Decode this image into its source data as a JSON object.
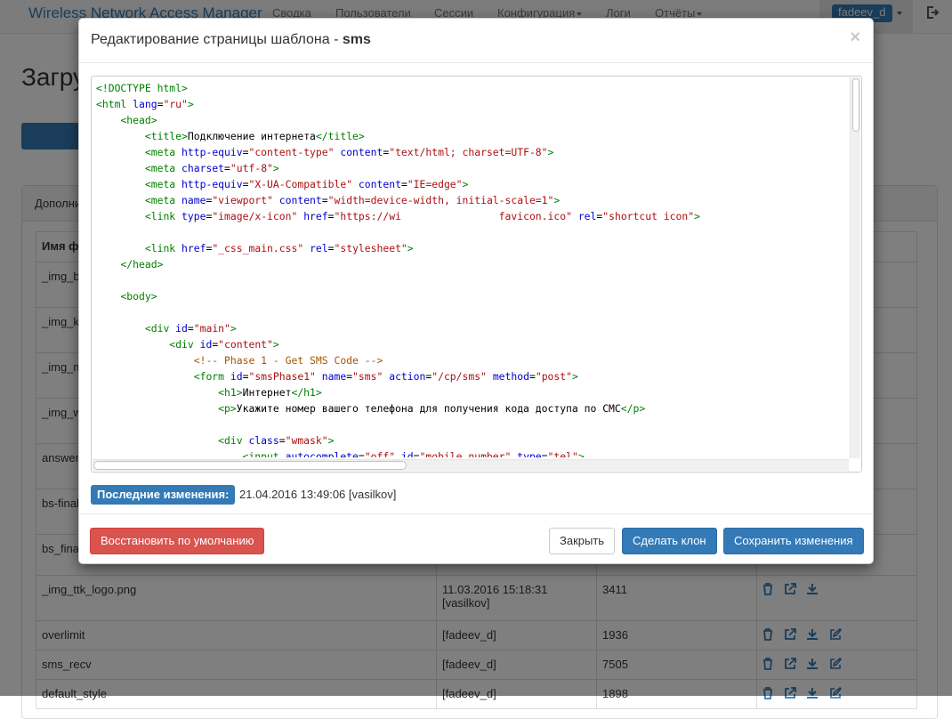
{
  "navbar": {
    "brand": "Wireless Network Access Manager",
    "items": [
      {
        "label": "Сводка",
        "dropdown": false
      },
      {
        "label": "Пользователи",
        "dropdown": false
      },
      {
        "label": "Сессии",
        "dropdown": false
      },
      {
        "label": "Конфигурация",
        "dropdown": true
      },
      {
        "label": "Логи",
        "dropdown": false
      },
      {
        "label": "Отчёты",
        "dropdown": true
      }
    ],
    "user": "fadeev_d"
  },
  "page": {
    "title_partial": "Загру",
    "panel_heading_partial": "Дополни"
  },
  "table": {
    "header_col1_partial": "Имя ф",
    "partial_rows": [
      "_img_b",
      "_img_k",
      "_img_m",
      "_img_w",
      "answer",
      "bs-final",
      "bs_fina"
    ],
    "rows": [
      {
        "name": "_img_ttk_logo.png",
        "changed": "11.03.2016 15:18:31\n[vasilkov]",
        "size": "3411",
        "edit_icon": false
      },
      {
        "name": "overlimit",
        "changed": "[fadeev_d]",
        "size": "1936",
        "edit_icon": true
      },
      {
        "name": "sms_recv",
        "changed": "[fadeev_d]",
        "size": "7505",
        "edit_icon": true
      },
      {
        "name": "default_style",
        "changed": "[fadeev_d]",
        "size": "1898",
        "edit_icon": true
      }
    ]
  },
  "modal": {
    "title_prefix": "Редактирование страницы шаблона - ",
    "title_name": "sms",
    "close_glyph": "×",
    "code_lines": [
      [
        {
          "t": "tag",
          "v": "<!DOCTYPE html>"
        }
      ],
      [
        {
          "t": "tag",
          "v": "<html "
        },
        {
          "t": "attr",
          "v": "lang"
        },
        {
          "t": "txt",
          "v": "="
        },
        {
          "t": "str",
          "v": "\"ru\""
        },
        {
          "t": "tag",
          "v": ">"
        }
      ],
      [
        {
          "t": "txt",
          "v": "    "
        },
        {
          "t": "tag",
          "v": "<head>"
        }
      ],
      [
        {
          "t": "txt",
          "v": "        "
        },
        {
          "t": "tag",
          "v": "<title>"
        },
        {
          "t": "txt",
          "v": "Подключение интернета"
        },
        {
          "t": "tag",
          "v": "</title>"
        }
      ],
      [
        {
          "t": "txt",
          "v": "        "
        },
        {
          "t": "tag",
          "v": "<meta "
        },
        {
          "t": "attr",
          "v": "http-equiv"
        },
        {
          "t": "txt",
          "v": "="
        },
        {
          "t": "str",
          "v": "\"content-type\""
        },
        {
          "t": "txt",
          "v": " "
        },
        {
          "t": "attr",
          "v": "content"
        },
        {
          "t": "txt",
          "v": "="
        },
        {
          "t": "str",
          "v": "\"text/html; charset=UTF-8\""
        },
        {
          "t": "tag",
          "v": ">"
        }
      ],
      [
        {
          "t": "txt",
          "v": "        "
        },
        {
          "t": "tag",
          "v": "<meta "
        },
        {
          "t": "attr",
          "v": "charset"
        },
        {
          "t": "txt",
          "v": "="
        },
        {
          "t": "str",
          "v": "\"utf-8\""
        },
        {
          "t": "tag",
          "v": ">"
        }
      ],
      [
        {
          "t": "txt",
          "v": "        "
        },
        {
          "t": "tag",
          "v": "<meta "
        },
        {
          "t": "attr",
          "v": "http-equiv"
        },
        {
          "t": "txt",
          "v": "="
        },
        {
          "t": "str",
          "v": "\"X-UA-Compatible\""
        },
        {
          "t": "txt",
          "v": " "
        },
        {
          "t": "attr",
          "v": "content"
        },
        {
          "t": "txt",
          "v": "="
        },
        {
          "t": "str",
          "v": "\"IE=edge\""
        },
        {
          "t": "tag",
          "v": ">"
        }
      ],
      [
        {
          "t": "txt",
          "v": "        "
        },
        {
          "t": "tag",
          "v": "<meta "
        },
        {
          "t": "attr",
          "v": "name"
        },
        {
          "t": "txt",
          "v": "="
        },
        {
          "t": "str",
          "v": "\"viewport\""
        },
        {
          "t": "txt",
          "v": " "
        },
        {
          "t": "attr",
          "v": "content"
        },
        {
          "t": "txt",
          "v": "="
        },
        {
          "t": "str",
          "v": "\"width=device-width, initial-scale=1\""
        },
        {
          "t": "tag",
          "v": ">"
        }
      ],
      [
        {
          "t": "txt",
          "v": "        "
        },
        {
          "t": "tag",
          "v": "<link "
        },
        {
          "t": "attr",
          "v": "type"
        },
        {
          "t": "txt",
          "v": "="
        },
        {
          "t": "str",
          "v": "\"image/x-icon\""
        },
        {
          "t": "txt",
          "v": " "
        },
        {
          "t": "attr",
          "v": "href"
        },
        {
          "t": "txt",
          "v": "="
        },
        {
          "t": "str",
          "v": "\"https://wi                favicon.ico\""
        },
        {
          "t": "txt",
          "v": " "
        },
        {
          "t": "attr",
          "v": "rel"
        },
        {
          "t": "txt",
          "v": "="
        },
        {
          "t": "str",
          "v": "\"shortcut icon\""
        },
        {
          "t": "tag",
          "v": ">"
        }
      ],
      [
        {
          "t": "txt",
          "v": ""
        }
      ],
      [
        {
          "t": "txt",
          "v": "        "
        },
        {
          "t": "tag",
          "v": "<link "
        },
        {
          "t": "attr",
          "v": "href"
        },
        {
          "t": "txt",
          "v": "="
        },
        {
          "t": "str",
          "v": "\"_css_main.css\""
        },
        {
          "t": "txt",
          "v": " "
        },
        {
          "t": "attr",
          "v": "rel"
        },
        {
          "t": "txt",
          "v": "="
        },
        {
          "t": "str",
          "v": "\"stylesheet\""
        },
        {
          "t": "tag",
          "v": ">"
        }
      ],
      [
        {
          "t": "txt",
          "v": "    "
        },
        {
          "t": "tag",
          "v": "</head>"
        }
      ],
      [
        {
          "t": "txt",
          "v": ""
        }
      ],
      [
        {
          "t": "txt",
          "v": "    "
        },
        {
          "t": "tag",
          "v": "<body>"
        }
      ],
      [
        {
          "t": "txt",
          "v": ""
        }
      ],
      [
        {
          "t": "txt",
          "v": "        "
        },
        {
          "t": "tag",
          "v": "<div "
        },
        {
          "t": "attr",
          "v": "id"
        },
        {
          "t": "txt",
          "v": "="
        },
        {
          "t": "str",
          "v": "\"main\""
        },
        {
          "t": "tag",
          "v": ">"
        }
      ],
      [
        {
          "t": "txt",
          "v": "            "
        },
        {
          "t": "tag",
          "v": "<div "
        },
        {
          "t": "attr",
          "v": "id"
        },
        {
          "t": "txt",
          "v": "="
        },
        {
          "t": "str",
          "v": "\"content\""
        },
        {
          "t": "tag",
          "v": ">"
        }
      ],
      [
        {
          "t": "txt",
          "v": "                "
        },
        {
          "t": "cmt",
          "v": "<!-- Phase 1 - Get SMS Code -->"
        }
      ],
      [
        {
          "t": "txt",
          "v": "                "
        },
        {
          "t": "tag",
          "v": "<form "
        },
        {
          "t": "attr",
          "v": "id"
        },
        {
          "t": "txt",
          "v": "="
        },
        {
          "t": "str",
          "v": "\"smsPhase1\""
        },
        {
          "t": "txt",
          "v": " "
        },
        {
          "t": "attr",
          "v": "name"
        },
        {
          "t": "txt",
          "v": "="
        },
        {
          "t": "str",
          "v": "\"sms\""
        },
        {
          "t": "txt",
          "v": " "
        },
        {
          "t": "attr",
          "v": "action"
        },
        {
          "t": "txt",
          "v": "="
        },
        {
          "t": "str",
          "v": "\"/cp/sms\""
        },
        {
          "t": "txt",
          "v": " "
        },
        {
          "t": "attr",
          "v": "method"
        },
        {
          "t": "txt",
          "v": "="
        },
        {
          "t": "str",
          "v": "\"post\""
        },
        {
          "t": "tag",
          "v": ">"
        }
      ],
      [
        {
          "t": "txt",
          "v": "                    "
        },
        {
          "t": "tag",
          "v": "<h1>"
        },
        {
          "t": "txt",
          "v": "Интернет"
        },
        {
          "t": "tag",
          "v": "</h1>"
        }
      ],
      [
        {
          "t": "txt",
          "v": "                    "
        },
        {
          "t": "tag",
          "v": "<p>"
        },
        {
          "t": "txt",
          "v": "Укажите номер вашего телефона для получения кода доступа по СМС"
        },
        {
          "t": "tag",
          "v": "</p>"
        }
      ],
      [
        {
          "t": "txt",
          "v": ""
        }
      ],
      [
        {
          "t": "txt",
          "v": "                    "
        },
        {
          "t": "tag",
          "v": "<div "
        },
        {
          "t": "attr",
          "v": "class"
        },
        {
          "t": "txt",
          "v": "="
        },
        {
          "t": "str",
          "v": "\"wmask\""
        },
        {
          "t": "tag",
          "v": ">"
        }
      ],
      [
        {
          "t": "txt",
          "v": "                        "
        },
        {
          "t": "tag",
          "v": "<input "
        },
        {
          "t": "attr",
          "v": "autocomplete"
        },
        {
          "t": "txt",
          "v": "="
        },
        {
          "t": "str",
          "v": "\"off\""
        },
        {
          "t": "txt",
          "v": " "
        },
        {
          "t": "attr",
          "v": "id"
        },
        {
          "t": "txt",
          "v": "="
        },
        {
          "t": "str",
          "v": "\"mobile_number\""
        },
        {
          "t": "txt",
          "v": " "
        },
        {
          "t": "attr",
          "v": "type"
        },
        {
          "t": "txt",
          "v": "="
        },
        {
          "t": "str",
          "v": "\"tel\""
        },
        {
          "t": "tag",
          "v": ">"
        }
      ]
    ],
    "last_changes_label": "Последние изменения:",
    "last_changes_value": "21.04.2016 13:49:06 [vasilkov]",
    "buttons": {
      "restore": "Восстановить по умолчанию",
      "close": "Закрыть",
      "clone": "Сделать клон",
      "save": "Сохранить изменения"
    }
  },
  "colors": {
    "primary": "#337ab7",
    "danger": "#d9534f",
    "tag": "#008000",
    "attr": "#0000cc",
    "string": "#aa1111",
    "comment": "#aa5500"
  }
}
